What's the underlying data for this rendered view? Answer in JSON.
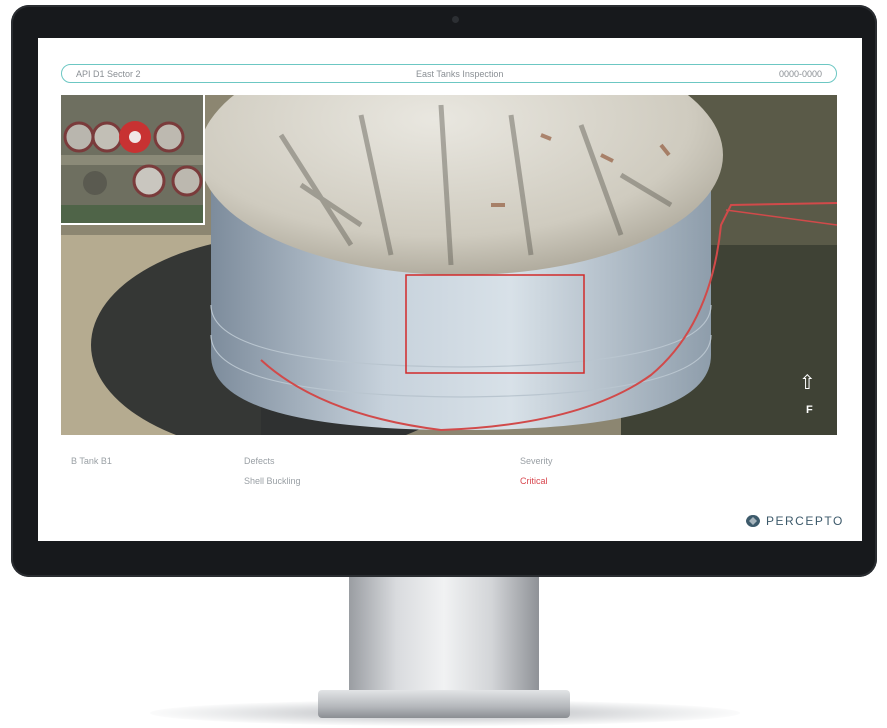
{
  "header": {
    "left_text": "API D1 Sector 2",
    "center_text": "East Tanks Inspection",
    "right_text": "0000-0000"
  },
  "compass": {
    "arrow_glyph": "⇧",
    "label": "F"
  },
  "details": {
    "id_label": "B Tank B1",
    "category_label": "Defects",
    "category_value": "Shell Buckling",
    "severity_label": "Severity",
    "severity_value": "Critical"
  },
  "brand": {
    "name": "PERCEPTO"
  },
  "colors": {
    "accent": "#6cc7c3",
    "critical": "#d9474f",
    "annotation": "#d12a2a",
    "brand": "#3d5a6b"
  }
}
